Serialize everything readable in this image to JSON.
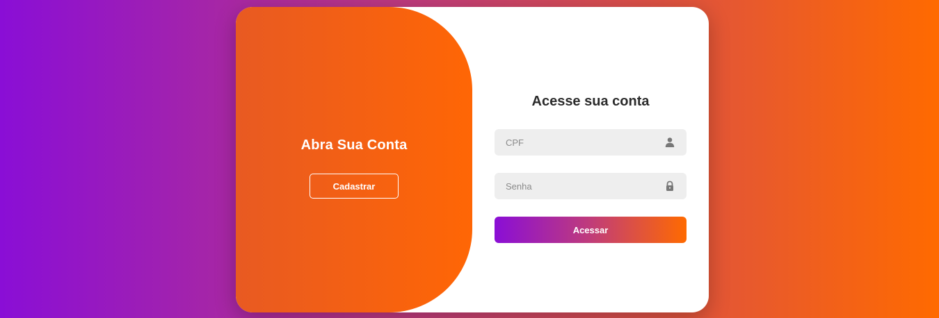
{
  "left_panel": {
    "title": "Abra Sua Conta",
    "signup_label": "Cadastrar"
  },
  "login_form": {
    "title": "Acesse sua conta",
    "cpf": {
      "placeholder": "CPF",
      "value": "",
      "icon": "user-icon"
    },
    "password": {
      "placeholder": "Senha",
      "value": "",
      "icon": "lock-icon"
    },
    "submit_label": "Acessar"
  },
  "colors": {
    "purple": "#8a0ed6",
    "orange": "#ff6a00",
    "left_panel_start": "#e85a22",
    "left_panel_end": "#ff6605",
    "input_background": "#eeeeee",
    "title_text": "#2b2b2b",
    "icon_gray": "#777777"
  }
}
